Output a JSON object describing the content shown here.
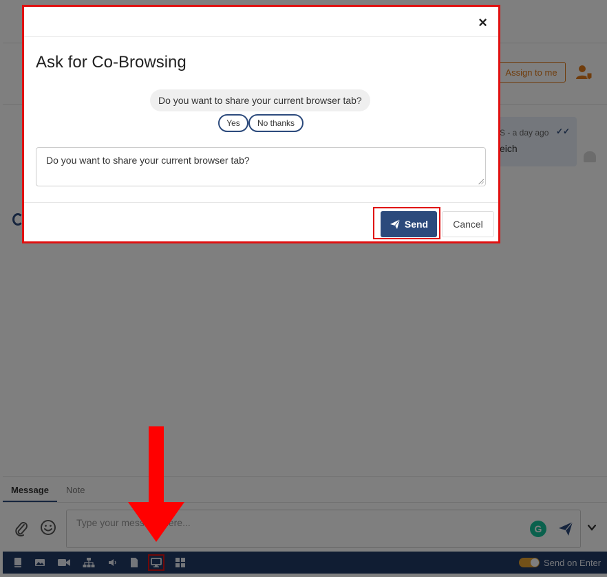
{
  "header": {
    "assign_label": "Assign to me"
  },
  "conversation": {
    "message_meta": "S - a day ago",
    "message_text": "eich"
  },
  "composer": {
    "tabs": [
      {
        "label": "Message"
      },
      {
        "label": "Note"
      }
    ],
    "input_placeholder": "Type your message here...",
    "grammarly_letter": "G"
  },
  "toolbar": {
    "icons": [
      "book-icon",
      "image-icon",
      "video-icon",
      "sitemap-icon",
      "volume-icon",
      "file-icon",
      "monitor-icon",
      "layout-grid-icon"
    ],
    "highlighted_icon": "monitor-icon",
    "send_on_enter_label": "Send on Enter",
    "send_on_enter": true
  },
  "modal": {
    "title": "Ask for Co-Browsing",
    "close_label": "×",
    "preview_question": "Do you want to share your current browser tab?",
    "preview_buttons": {
      "yes": "Yes",
      "no": "No thanks"
    },
    "textarea_value": "Do you want to share your current browser tab?",
    "send_label": "Send",
    "cancel_label": "Cancel"
  },
  "colors": {
    "primary": "#2c4a7c",
    "annotation_red": "#ff0000",
    "assign_orange": "#e07b1a",
    "toggle_on": "#e6a230",
    "toolbar_bg": "#213a66"
  }
}
